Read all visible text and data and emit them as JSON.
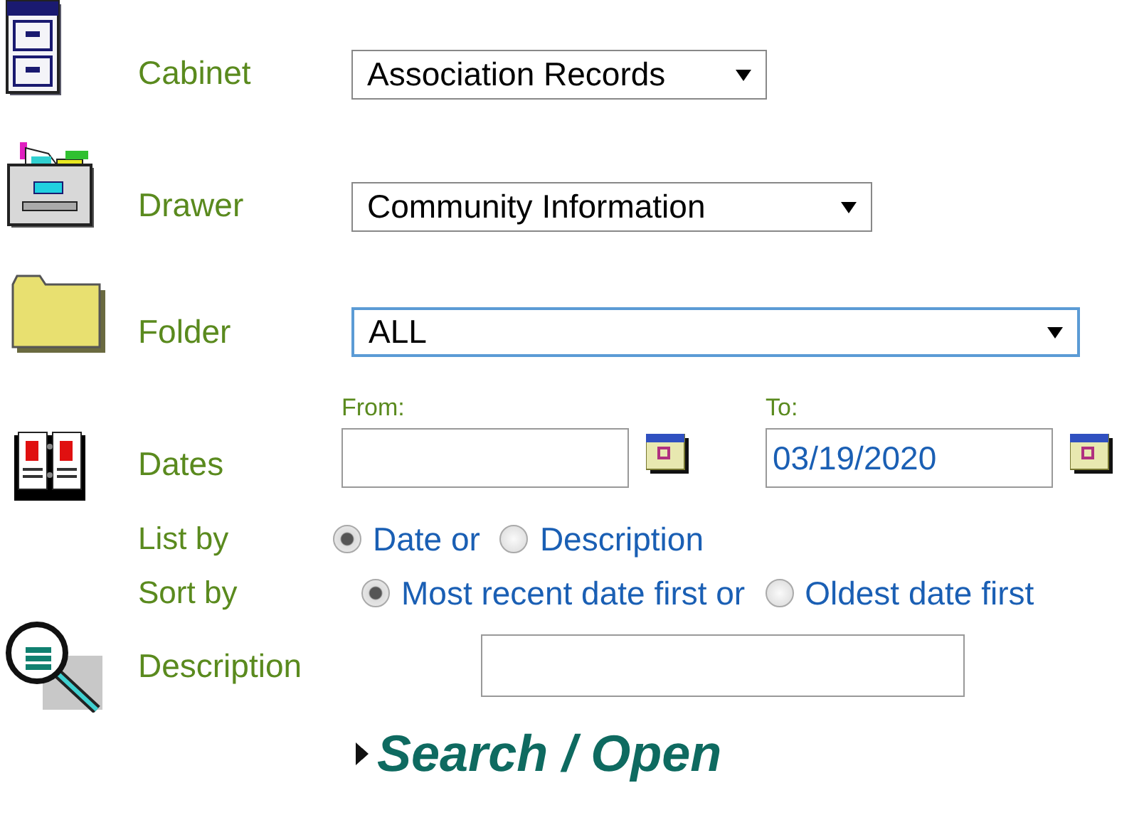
{
  "cabinet": {
    "label": "Cabinet",
    "value": "Association Records"
  },
  "drawer": {
    "label": "Drawer",
    "value": "Community Information"
  },
  "folder": {
    "label": "Folder",
    "value": "ALL",
    "focused": true
  },
  "dates": {
    "label": "Dates",
    "from_label": "From:",
    "to_label": "To:",
    "to_value": "03/19/2020"
  },
  "list_by": {
    "label": "List by",
    "options": [
      {
        "label": "Date or",
        "selected": true
      },
      {
        "label": "Description",
        "selected": false
      }
    ]
  },
  "sort_by": {
    "label": "Sort by",
    "options": [
      {
        "label": "Most recent date first or",
        "selected": true
      },
      {
        "label": "Oldest date first",
        "selected": false
      }
    ]
  },
  "description": {
    "label": "Description"
  },
  "search_button": {
    "label": "Search / Open"
  }
}
